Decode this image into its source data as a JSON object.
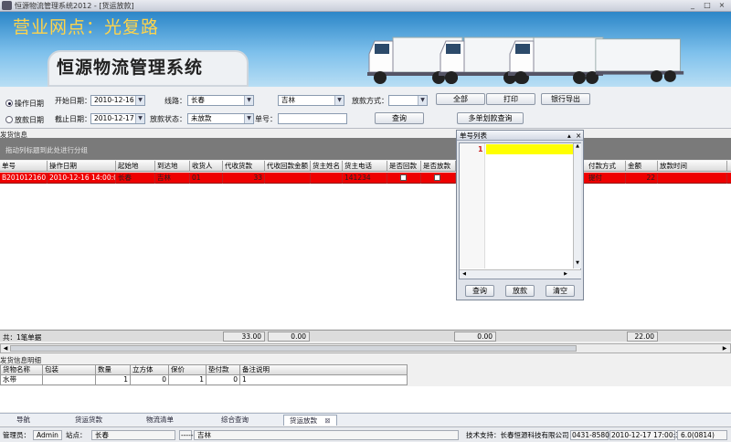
{
  "window": {
    "title": "恒源物流管理系统2012 - [货运放款]",
    "btn_min": "_",
    "btn_max": "□",
    "btn_close": "×"
  },
  "banner": {
    "branch": "营业网点：光复路",
    "system_name": "恒源物流管理系统"
  },
  "filters": {
    "radio_op_date": "操作日期",
    "radio_pay_date": "放款日期",
    "start_label": "开始日期：",
    "start_value": "2010-12-16",
    "end_label": "截止日期：",
    "end_value": "2010-12-17",
    "route_label": "线路：",
    "route_from": "长春",
    "route_to": "吉林",
    "pay_method_label": "放款方式：",
    "pay_method_value": "",
    "pay_status_label": "放款状态：",
    "pay_status_value": "未放款",
    "order_no_label": "单号：",
    "order_no_value": "",
    "btn_all": "全部",
    "btn_print": "打印",
    "btn_bank_export": "银行导出",
    "btn_query": "查询",
    "btn_multi_query": "多单划款查询"
  },
  "grid": {
    "section_title": "发货信息",
    "group_hint": "拖动列标题到此处进行分组",
    "columns": [
      "单号",
      "操作日期",
      "起始地",
      "到达地",
      "收货人",
      "代收货款",
      "代收回款金额",
      "货主姓名",
      "货主电话",
      "是否回款",
      "是否放款",
      "付款方式",
      "金额",
      "放款时间"
    ],
    "row": {
      "order_no": "B201012160",
      "op_date": "2010-12-16 14:00:05",
      "origin": "长春",
      "dest": "吉林",
      "consignee": "01",
      "cod": "33",
      "cod_return": "",
      "owner_name": "",
      "owner_phone": "141234",
      "returned": "",
      "paid": "",
      "pay_method": "提付",
      "amount": "22",
      "pay_time": ""
    },
    "summary": {
      "count": "共：1笔单据",
      "cod_total": "33.00",
      "return_total": "0.00",
      "mid_total": "0.00",
      "amount_total": "22.00"
    }
  },
  "detail": {
    "title": "发货信息明细",
    "columns": [
      "货物名称",
      "包装",
      "数量",
      "立方体",
      "保价",
      "垫付款",
      "备注说明"
    ],
    "row": [
      "水带",
      "",
      "1",
      "0",
      "1",
      "0",
      "1"
    ]
  },
  "popup": {
    "title": "单号列表",
    "pin": "▴",
    "close": "×",
    "line_no": "1",
    "btn_query": "查询",
    "btn_pay": "放款",
    "btn_clear": "清空"
  },
  "tabs": [
    "导航",
    "货运货款",
    "物流清单",
    "综合查询",
    "货运放款"
  ],
  "tab_close": "⊠",
  "status": {
    "admin_label": "管理员：",
    "admin": "Admin",
    "site_label": "站点：",
    "site": "长春",
    "dashes": "-----",
    "route": "吉林",
    "support": "技术支持：长春恒源科技有限公司",
    "phone": "0431-858065",
    "datetime": "2010-12-17 17:00:31",
    "version": "6.0(0814)"
  },
  "colors": {
    "selected_row": "#ee0000",
    "banner_top": "#2b86c8",
    "highlight": "#ffff00"
  }
}
